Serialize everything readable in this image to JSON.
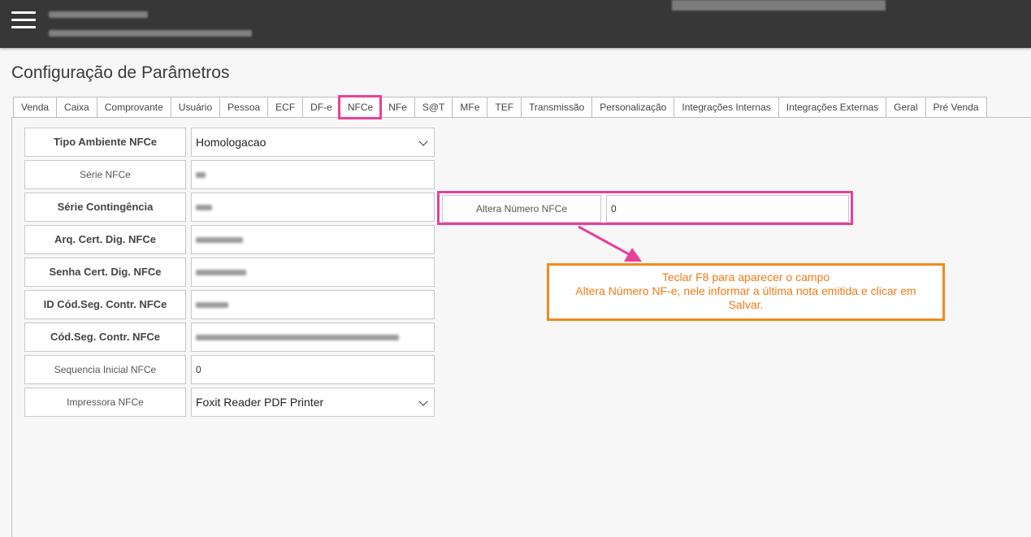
{
  "app": {
    "title": "Configuração de Parâmetros"
  },
  "tabs": [
    {
      "label": "Venda"
    },
    {
      "label": "Caixa"
    },
    {
      "label": "Comprovante"
    },
    {
      "label": "Usuário"
    },
    {
      "label": "Pessoa"
    },
    {
      "label": "ECF"
    },
    {
      "label": "DF-e"
    },
    {
      "label": "NFCe",
      "active": true
    },
    {
      "label": "NFe"
    },
    {
      "label": "S@T"
    },
    {
      "label": "MFe"
    },
    {
      "label": "TEF"
    },
    {
      "label": "Transmissão"
    },
    {
      "label": "Personalização"
    },
    {
      "label": "Integrações Internas"
    },
    {
      "label": "Integrações Externas"
    },
    {
      "label": "Geral"
    },
    {
      "label": "Pré Venda"
    }
  ],
  "form": {
    "tipo_ambiente": {
      "label": "Tipo Ambiente NFCe",
      "value": "Homologacao"
    },
    "serie": {
      "label": "Série NFCe"
    },
    "serie_contingencia": {
      "label": "Série Contingência"
    },
    "arq_cert": {
      "label": "Arq. Cert. Dig. NFCe"
    },
    "senha_cert": {
      "label": "Senha Cert. Dig. NFCe"
    },
    "id_cod_seg": {
      "label": "ID Cód.Seg. Contr. NFCe"
    },
    "cod_seg": {
      "label": "Cód.Seg. Contr. NFCe"
    },
    "sequencia_inicial": {
      "label": "Sequencia Inicial NFCe",
      "value": "0"
    },
    "impressora": {
      "label": "Impressora NFCe",
      "value": "Foxit Reader PDF Printer"
    },
    "altera_numero": {
      "label": "Altera Número NFCe",
      "value": "0"
    }
  },
  "note": {
    "line1": "Teclar F8 para aparecer o campo",
    "line2": "Altera Número NF-e, nele informar a última nota emitida e clicar em",
    "line3": "Salvar."
  },
  "colors": {
    "topbar": "#373737",
    "highlight_pink": "#e8409b",
    "note_orange": "#f28b1c"
  },
  "icons": {
    "menu": "hamburger-menu-icon",
    "dropdown": "chevron-down-icon"
  }
}
